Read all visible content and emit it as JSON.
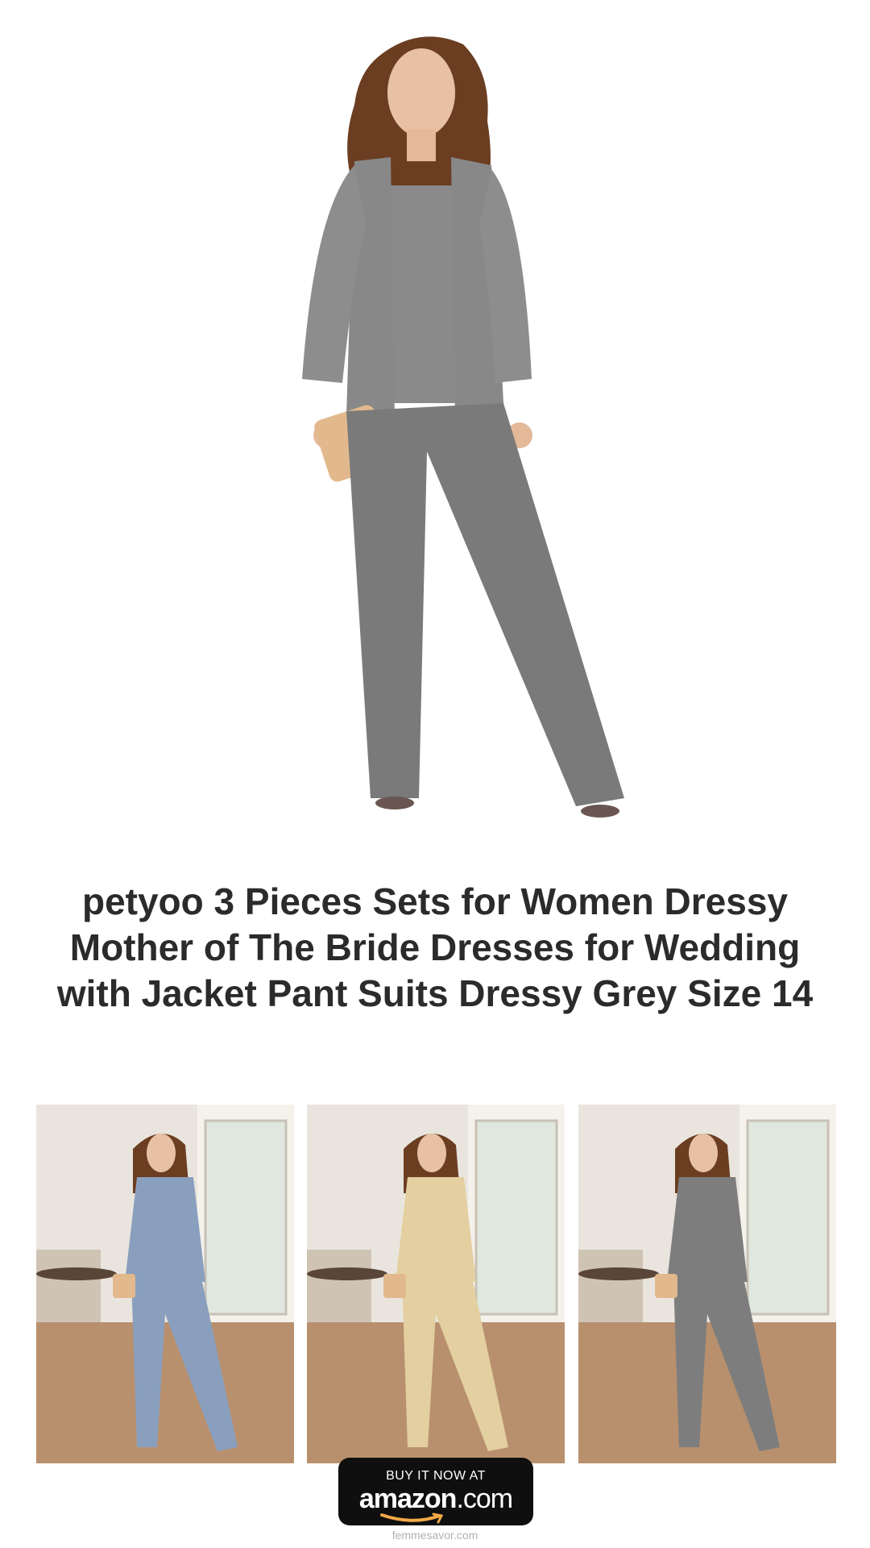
{
  "product": {
    "title": "petyoo 3 Pieces Sets for Women Dressy Mother of The Bride Dresses for Wedding with Jacket Pant Suits Dressy Grey Size 14",
    "hero_color": "#7a7a7a"
  },
  "variants": [
    {
      "color": "#8a9fbd"
    },
    {
      "color": "#e3cfa0"
    },
    {
      "color": "#7d7d7d"
    }
  ],
  "cta": {
    "top_label": "BUY IT NOW AT",
    "brand": "amazon",
    "brand_suffix": ".com"
  },
  "footer": {
    "site": "femmesavor.com"
  }
}
